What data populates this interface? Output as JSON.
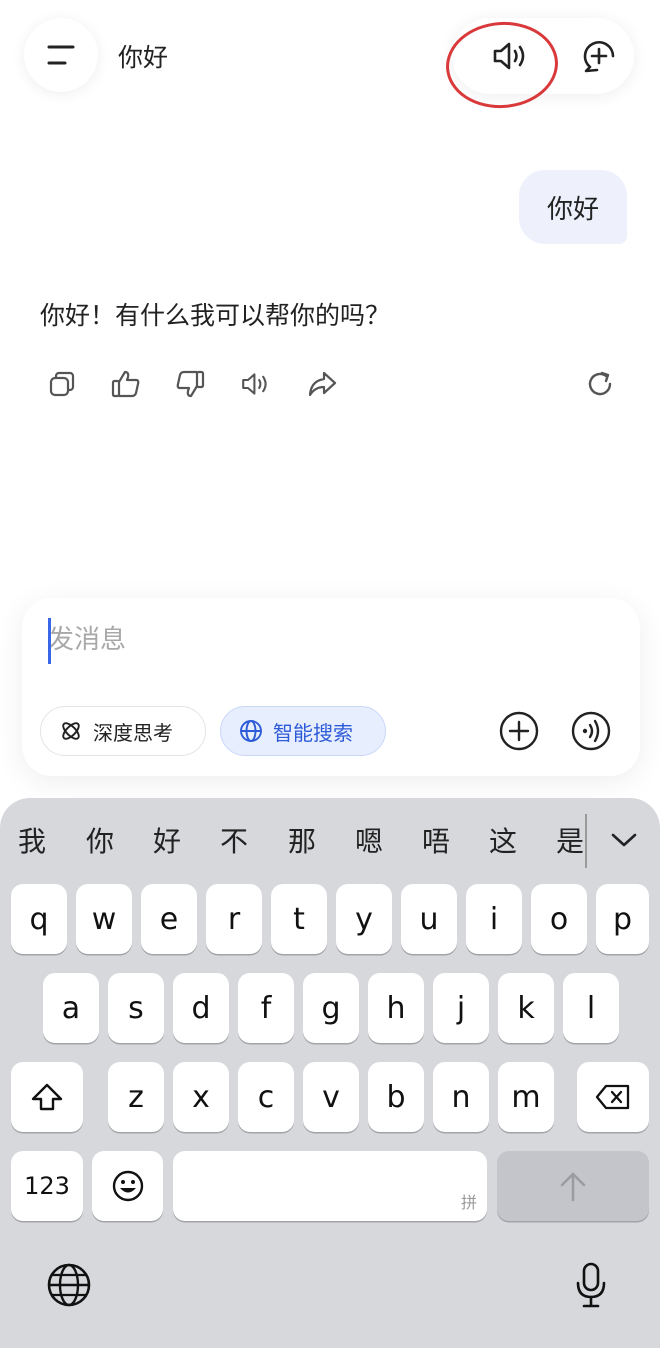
{
  "header": {
    "title": "你好",
    "menu_icon": "menu-icon",
    "speaker_icon": "speaker-icon",
    "new_chat_icon": "new-chat-icon"
  },
  "conversation": {
    "user_message": "你好",
    "assistant_message": "你好！有什么我可以帮你的吗？",
    "actions": [
      "copy-icon",
      "thumbs-up-icon",
      "thumbs-down-icon",
      "speaker-icon",
      "share-icon",
      "regenerate-icon"
    ]
  },
  "composer": {
    "placeholder": "发消息",
    "value": "",
    "chip_deep_think": "深度思考",
    "chip_web_search": "智能搜索"
  },
  "keyboard": {
    "candidates": [
      "我",
      "你",
      "好",
      "不",
      "那",
      "嗯",
      "唔",
      "这",
      "是"
    ],
    "row1": [
      "q",
      "w",
      "e",
      "r",
      "t",
      "y",
      "u",
      "i",
      "o",
      "p"
    ],
    "row2": [
      "a",
      "s",
      "d",
      "f",
      "g",
      "h",
      "j",
      "k",
      "l"
    ],
    "row3": [
      "z",
      "x",
      "c",
      "v",
      "b",
      "n",
      "m"
    ],
    "num_key": "123",
    "space_hint": "拼"
  },
  "colors": {
    "accent_blue": "#2e5bd8",
    "highlight_red": "#d9393b",
    "user_bubble": "#eef1fc",
    "keyboard_bg": "#d7d8dc"
  }
}
